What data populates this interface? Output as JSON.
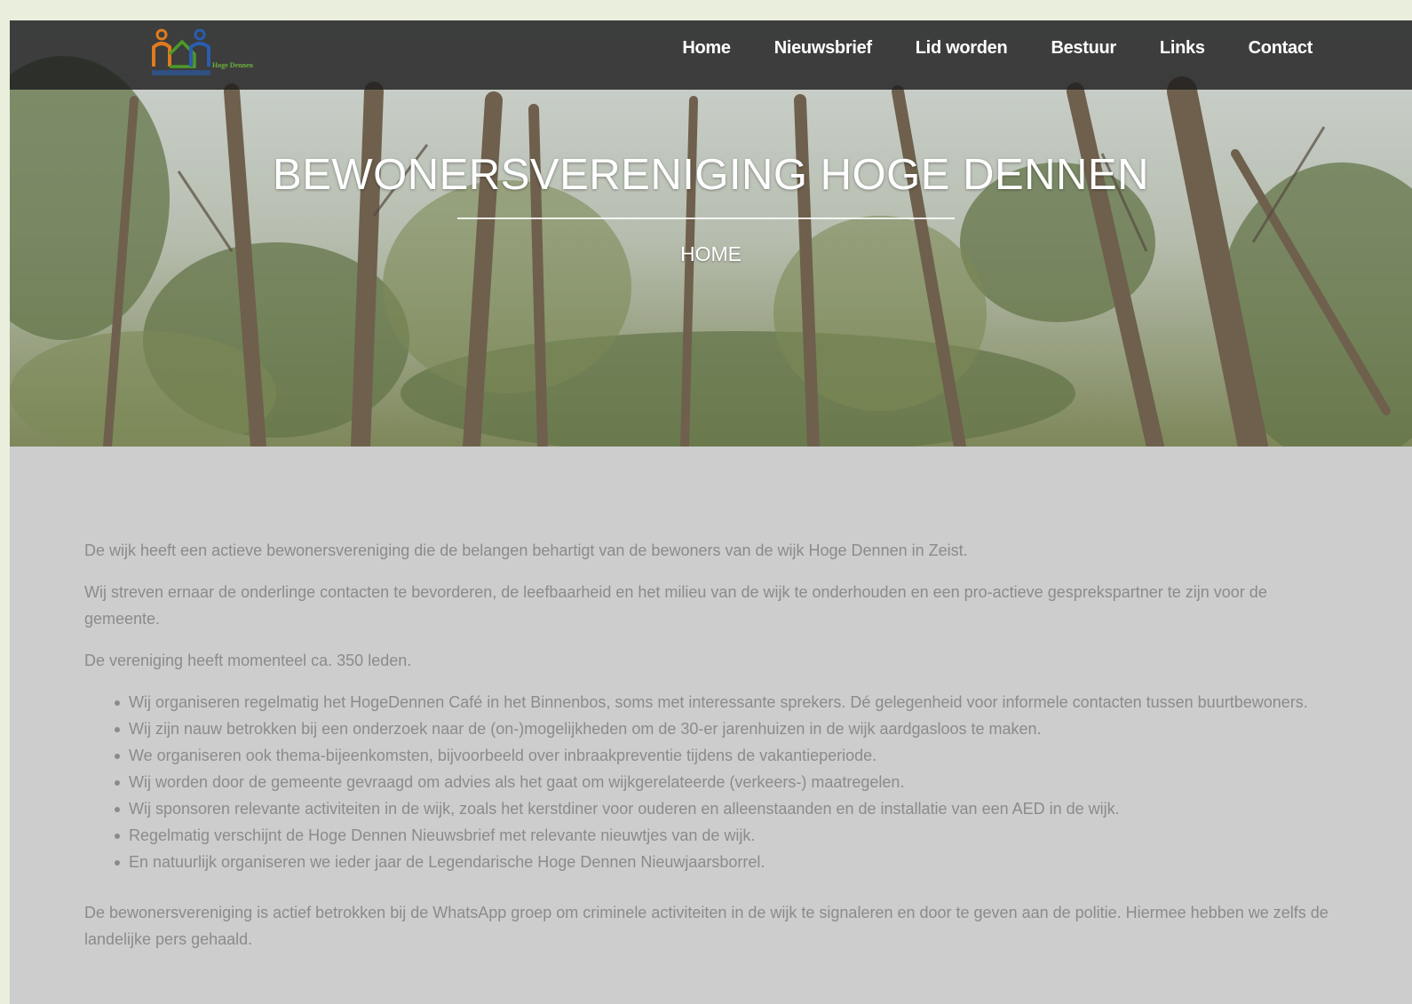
{
  "header": {
    "logo_text": "Hoge Dennen",
    "nav": [
      "Home",
      "Nieuwsbrief",
      "Lid worden",
      "Bestuur",
      "Links",
      "Contact"
    ]
  },
  "hero": {
    "title": "BEWONERSVERENIGING HOGE DENNEN",
    "subtitle": "HOME"
  },
  "content": {
    "intro": [
      "De wijk heeft een actieve bewonersvereniging die de belangen behartigt van de bewoners van de wijk Hoge Dennen  in Zeist.",
      "Wij streven ernaar de onderlinge contacten te bevorderen, de leefbaarheid en het milieu van de wijk te onderhouden en een pro-actieve gesprekspartner te zijn voor de gemeente.",
      "De vereniging heeft momenteel ca. 350 leden."
    ],
    "bullets": [
      "Wij organiseren regelmatig het HogeDennen Café in het Binnenbos, soms met interessante sprekers. Dé gelegenheid voor informele contacten tussen buurtbewoners.",
      "Wij zijn nauw betrokken bij een onderzoek naar de (on-)mogelijkheden om de 30-er jarenhuizen in de wijk aardgasloos te maken.",
      "We organiseren ook thema-bijeenkomsten, bijvoorbeeld over inbraakpreventie tijdens de vakantieperiode.",
      "Wij worden door de gemeente gevraagd om advies als het gaat om wijkgerelateerde (verkeers-) maatregelen.",
      "Wij sponsoren relevante activiteiten in de wijk, zoals het kerstdiner voor ouderen en alleenstaanden en de installatie van een AED in de wijk.",
      "Regelmatig verschijnt de Hoge Dennen Nieuwsbrief met relevante nieuwtjes van de wijk.",
      "En natuurlijk organiseren we ieder jaar de Legendarische Hoge Dennen Nieuwjaarsborrel."
    ],
    "outro": "De bewonersvereniging is actief betrokken bij de WhatsApp groep om criminele activiteiten in de wijk te signaleren en door te geven aan de politie. Hiermee hebben we zelfs de landelijke pers gehaald."
  }
}
